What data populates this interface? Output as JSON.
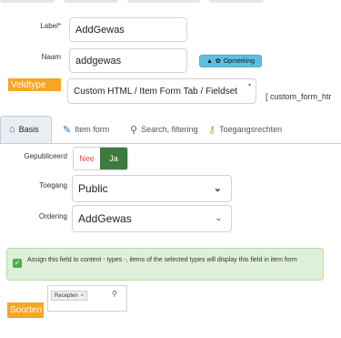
{
  "form": {
    "label_label": "Label",
    "label_required": "*",
    "label_value": "AddGewas",
    "naam_label": "Naam",
    "naam_value": "addgewas",
    "opmerking_label": "Opmerking",
    "veldtype_label": "Veldtype",
    "veldtype_value": "Custom HTML / Item Form Tab / Fieldset",
    "veldtype_code": "[ custom_form_htr"
  },
  "tabs": [
    {
      "label": "Basis",
      "icon": "home-icon"
    },
    {
      "label": "Item form",
      "icon": "edit-icon"
    },
    {
      "label": "Search, filtering",
      "icon": "search-icon"
    },
    {
      "label": "Toegangsrechten",
      "icon": "key-icon"
    }
  ],
  "basis": {
    "gepubliceerd_label": "Gepubliceerd",
    "nee": "Nee",
    "ja": "Ja",
    "toegang_label": "Toegang",
    "toegang_value": "Public",
    "ordering_label": "Ordering",
    "ordering_value": "AddGewas"
  },
  "assign": {
    "text": "Assign this field to content - types -, items of the selected types will display this field in item form"
  },
  "soorten": {
    "label": "Soorten",
    "chip": "Recepten",
    "chip_remove": "×"
  },
  "colors": {
    "orange": "#f5a623",
    "green": "#3d7a3f",
    "info_blue": "#5bc0de",
    "nee_red": "#d9534f",
    "success_bg": "#dff0d8"
  }
}
